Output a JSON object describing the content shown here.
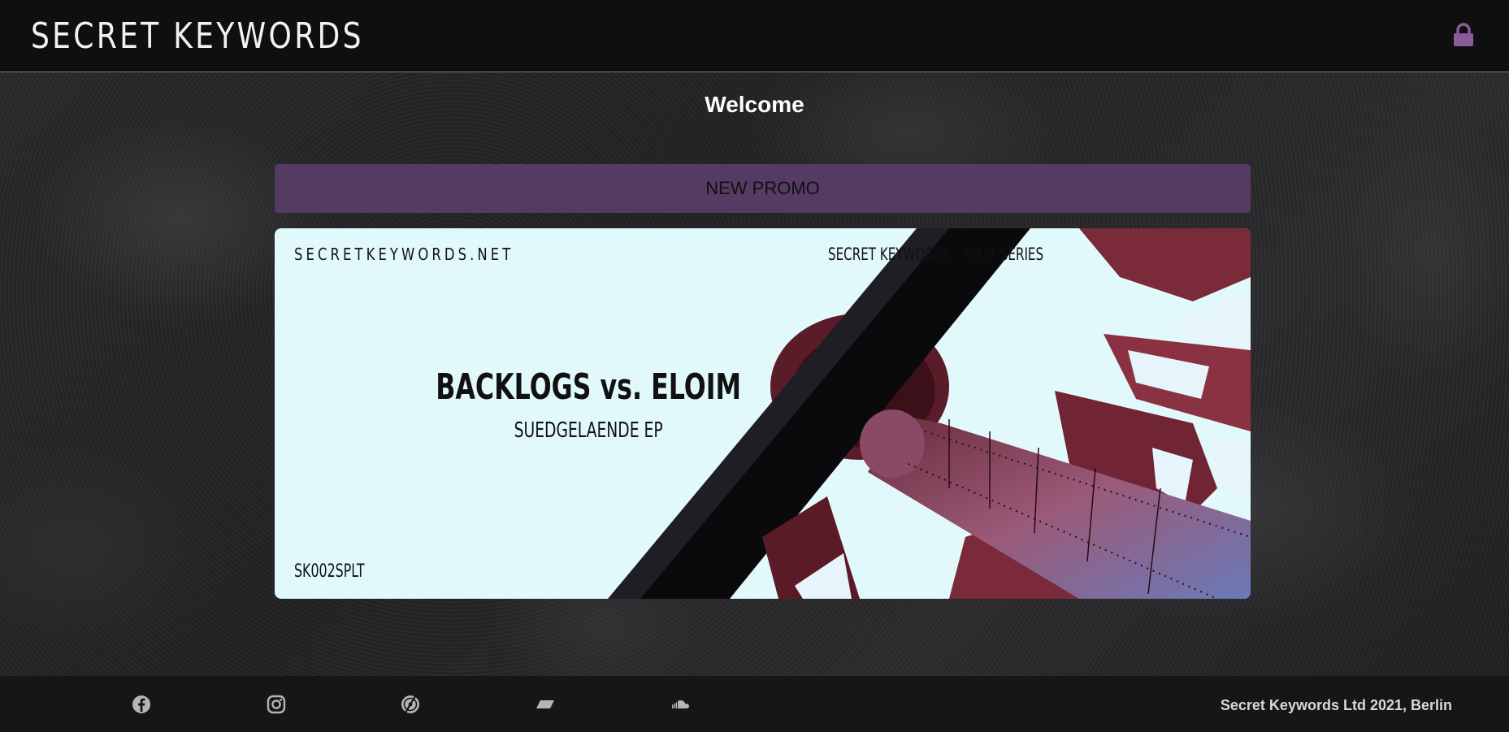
{
  "header": {
    "logo_text": "SECRET KEYWORDS",
    "lock_icon": "lock-icon",
    "accent_color": "#8a5a9a"
  },
  "main": {
    "welcome": "Welcome",
    "promo_button_label": "NEW PROMO",
    "promo_button_color": "#553a62",
    "banner": {
      "site": "SECRETKEYWORDS.NET",
      "series": "SECRET KEYWORDS - SPLIT SERIES",
      "artists": "BACKLOGS vs. ELOIM",
      "release": "SUEDGELAENDE EP",
      "catalog": "SK002SPLT",
      "background_color": "#e2f9fc"
    }
  },
  "footer": {
    "social_icons": [
      "facebook-icon",
      "instagram-icon",
      "discogs-icon",
      "bandcamp-icon",
      "soundcloud-icon"
    ],
    "copyright": "Secret Keywords Ltd 2021, Berlin"
  }
}
